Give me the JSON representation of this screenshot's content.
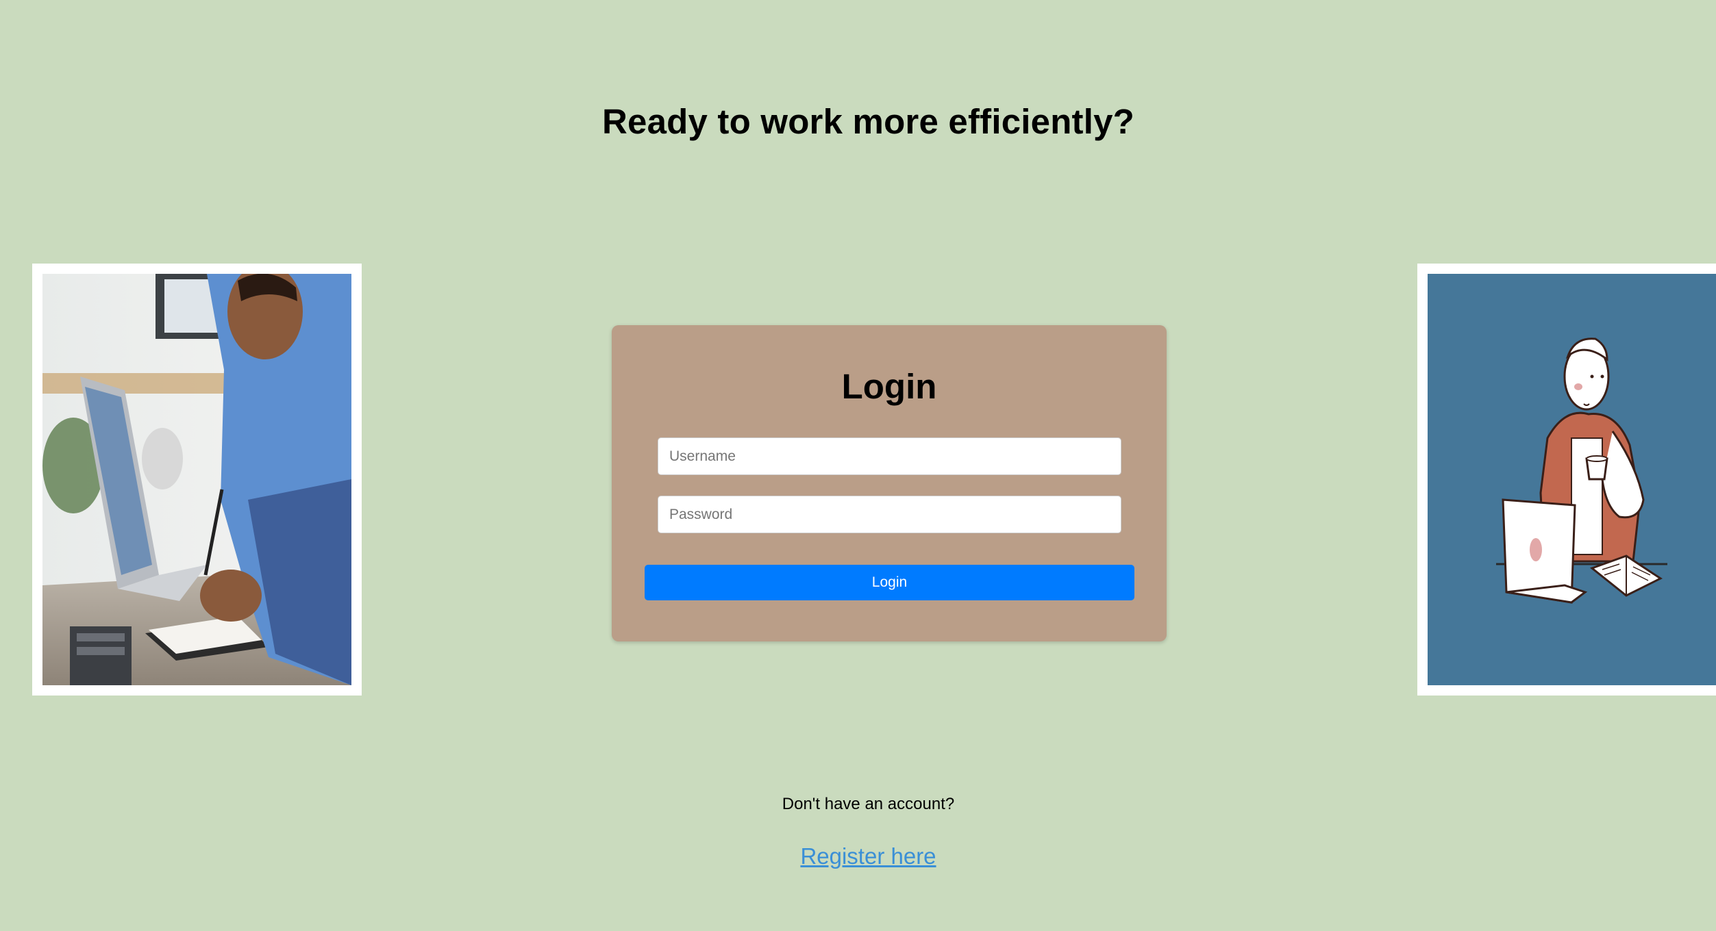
{
  "page": {
    "headline": "Ready to work more efficiently?"
  },
  "login": {
    "title": "Login",
    "username_placeholder": "Username",
    "password_placeholder": "Password",
    "button_label": "Login"
  },
  "footer": {
    "account_prompt": "Don't have an account?",
    "register_link": "Register here"
  },
  "colors": {
    "background": "#cadbbe",
    "card": "#ba9e88",
    "button": "#007bff",
    "link": "#3a8fd6",
    "illustration_bg": "#457799"
  },
  "images": {
    "left": "man-writing-at-laptop-photo",
    "right": "person-with-coffee-and-laptop-illustration"
  }
}
